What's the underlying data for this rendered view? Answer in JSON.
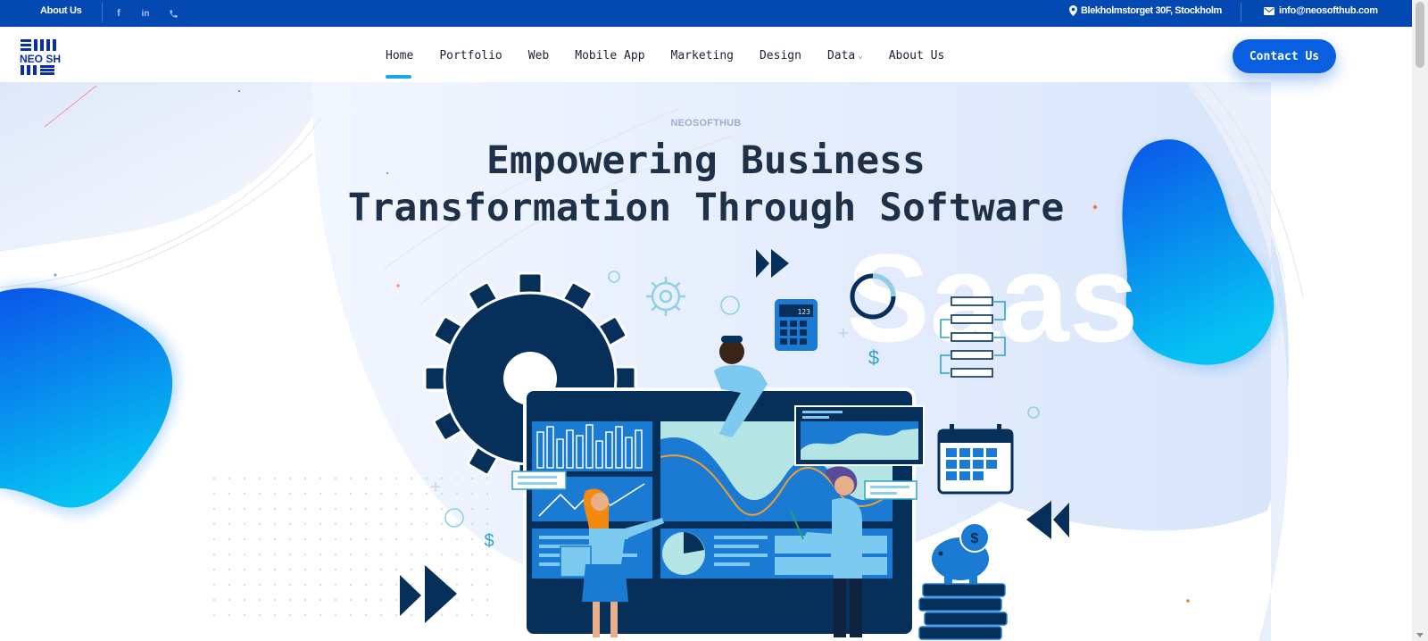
{
  "topbar": {
    "about_label": "About Us",
    "social_icons": [
      "facebook-icon",
      "linkedin-icon",
      "phone-icon"
    ],
    "address": "Blekholmstorget 30F, Stockholm",
    "email": "info@neosofthub.com"
  },
  "header": {
    "logo_text": "NEO SH",
    "nav": [
      {
        "label": "Home",
        "active": true
      },
      {
        "label": "Portfolio"
      },
      {
        "label": "Web"
      },
      {
        "label": "Mobile App"
      },
      {
        "label": "Marketing"
      },
      {
        "label": "Design"
      },
      {
        "label": "Data",
        "has_dropdown": true
      },
      {
        "label": "About Us"
      }
    ],
    "contact_label": "Contact Us"
  },
  "hero": {
    "eyebrow": "NEOSOFTHUB",
    "title_line1": "Empowering Business",
    "title_line2": "Transformation Through Software",
    "watermark": "Saas",
    "calculator_display": "123"
  },
  "colors": {
    "topbar": "#0448b1",
    "accent": "#0a5fe0",
    "nav_underline": "#16a8e8",
    "title": "#1f3148",
    "navy": "#06305a"
  }
}
